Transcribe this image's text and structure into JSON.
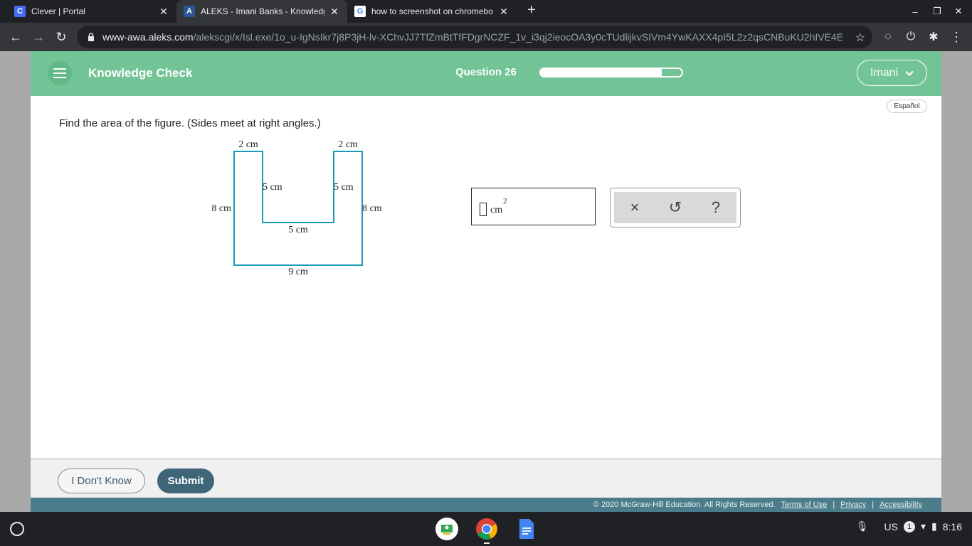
{
  "browser": {
    "tabs": [
      {
        "title": "Clever | Portal",
        "favicon": "C",
        "favicon_color": "#436cf2"
      },
      {
        "title": "ALEKS - Imani Banks - Knowledg",
        "favicon": "A",
        "favicon_color": "#2b5797"
      },
      {
        "title": "how to screenshot on chromebo",
        "favicon": "G",
        "favicon_color": "#ffffff"
      }
    ],
    "url_host": "www-awa.aleks.com",
    "url_path": "/alekscgi/x/Isl.exe/1o_u-IgNsIkr7j8P3jH-lv-XChvJJ7TfZmBtTfFDgrNCZF_1v_i3qj2ieocOA3y0cTUdlijkvSIVm4YwKAXX4pI5L2z2qsCNBuKU2hIVE4E..."
  },
  "app": {
    "title": "Knowledge Check",
    "question_label": "Question 26",
    "progress": 0.86,
    "user": "Imani",
    "language_toggle": "Español",
    "accent": "#72c496"
  },
  "problem": {
    "prompt": "Find the area of the figure. (Sides meet at right angles.)",
    "labels": {
      "top_left": "2 cm",
      "top_right": "2 cm",
      "inner_left": "5 cm",
      "inner_right": "5 cm",
      "outer_left": "8 cm",
      "outer_right": "8 cm",
      "inner_bottom": "5 cm",
      "bottom": "9 cm"
    },
    "answer_unit": "cm",
    "answer_exponent": "2"
  },
  "tools": {
    "clear": "×",
    "undo": "↺",
    "help": "?"
  },
  "actions": {
    "dont_know": "I Don't Know",
    "submit": "Submit"
  },
  "footer": {
    "copyright": "© 2020 McGraw-Hill Education. All Rights Reserved.",
    "terms": "Terms of Use",
    "privacy": "Privacy",
    "accessibility": "Accessibility",
    "separator": "|"
  },
  "shelf": {
    "locale": "US",
    "notifications": "1",
    "time": "8:16"
  }
}
